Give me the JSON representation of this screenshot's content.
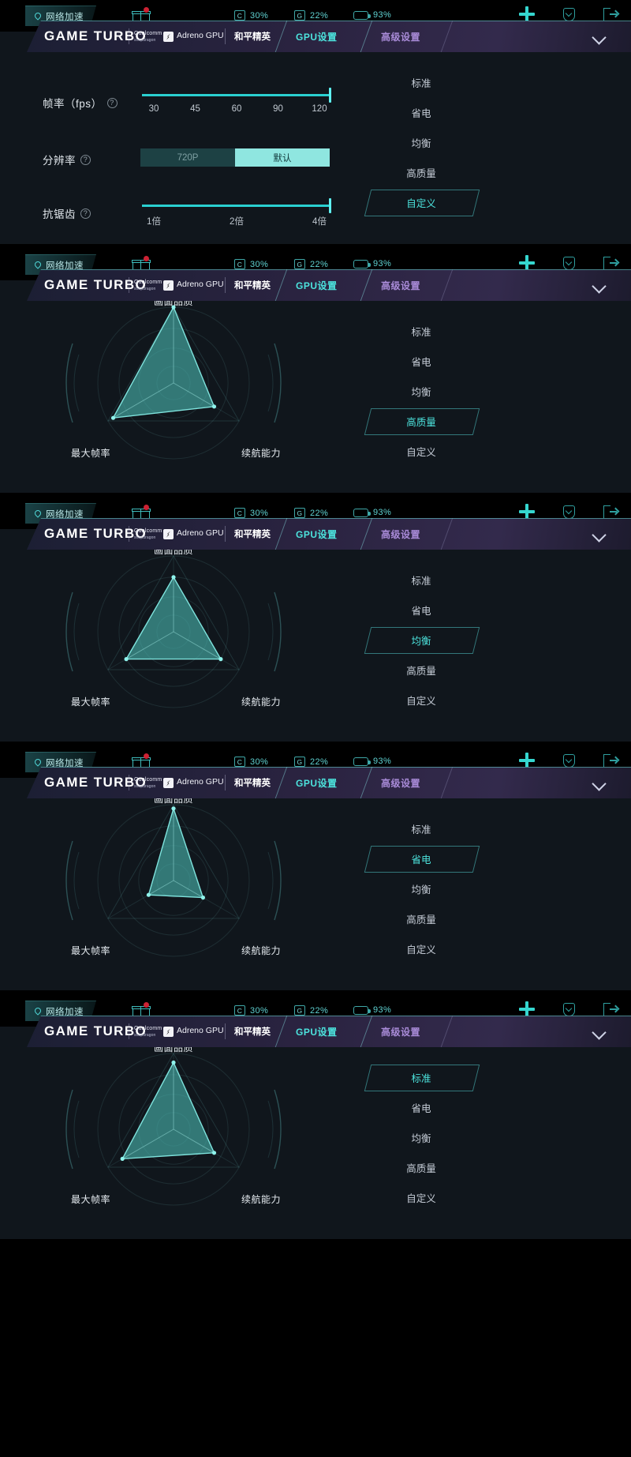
{
  "statusbar": {
    "network_label": "网络加速",
    "cpu": {
      "tag": "C",
      "value": "30%"
    },
    "gpu": {
      "tag": "G",
      "value": "22%"
    },
    "battery": {
      "value": "93%"
    },
    "icons": [
      "gift-icon",
      "plus-icon",
      "shield-icon",
      "exit-icon"
    ]
  },
  "header": {
    "brand": "GAME TURBO",
    "qualcomm": "Qualcomm",
    "qualcomm_sub": "snapdragon",
    "adreno": "Adreno GPU",
    "game_name": "和平精英",
    "tab_gpu": "GPU设置",
    "tab_advanced": "高级设置"
  },
  "presets": {
    "standard": "标准",
    "power_save": "省电",
    "balanced": "均衡",
    "high_quality": "高质量",
    "custom": "自定义"
  },
  "settings": {
    "fps": {
      "label": "帧率（fps）",
      "ticks": [
        "30",
        "45",
        "60",
        "90",
        "120"
      ],
      "value": "120"
    },
    "resolution": {
      "label": "分辨率",
      "options": [
        "720P",
        "默认"
      ],
      "selected": "默认"
    },
    "antialiasing": {
      "label": "抗锯齿",
      "ticks": [
        "1倍",
        "2倍",
        "4倍"
      ],
      "value": "4倍"
    }
  },
  "radar": {
    "axes": [
      "画面品质",
      "续航能力",
      "最大帧率"
    ],
    "top_label": "画面品质",
    "right_label": "续航能力",
    "left_label": "最大帧率"
  },
  "chart_data": [
    {
      "type": "radar",
      "title": "自定义",
      "categories": [
        "画面品质",
        "续航能力",
        "最大帧率"
      ],
      "values": [
        1.0,
        0.62,
        0.92
      ],
      "max": 1.0,
      "preset": "自定义"
    },
    {
      "type": "radar",
      "title": "高质量",
      "categories": [
        "画面品质",
        "续航能力",
        "最大帧率"
      ],
      "values": [
        1.0,
        0.62,
        0.92
      ],
      "max": 1.0,
      "preset": "高质量"
    },
    {
      "type": "radar",
      "title": "均衡",
      "categories": [
        "画面品质",
        "续航能力",
        "最大帧率"
      ],
      "values": [
        0.72,
        0.72,
        0.72
      ],
      "max": 1.0,
      "preset": "均衡"
    },
    {
      "type": "radar",
      "title": "省电",
      "categories": [
        "画面品质",
        "续航能力",
        "最大帧率"
      ],
      "values": [
        0.95,
        0.45,
        0.38
      ],
      "max": 1.0,
      "preset": "省电"
    },
    {
      "type": "radar",
      "title": "标准",
      "categories": [
        "画面品质",
        "续航能力",
        "最大帧率"
      ],
      "values": [
        0.88,
        0.62,
        0.78
      ],
      "max": 1.0,
      "preset": "标准"
    }
  ],
  "colors": {
    "accent": "#4ce3dd",
    "purple": "#a98bd8",
    "panel_bg": "#10161c",
    "radar_fill": "#49b4ae"
  }
}
